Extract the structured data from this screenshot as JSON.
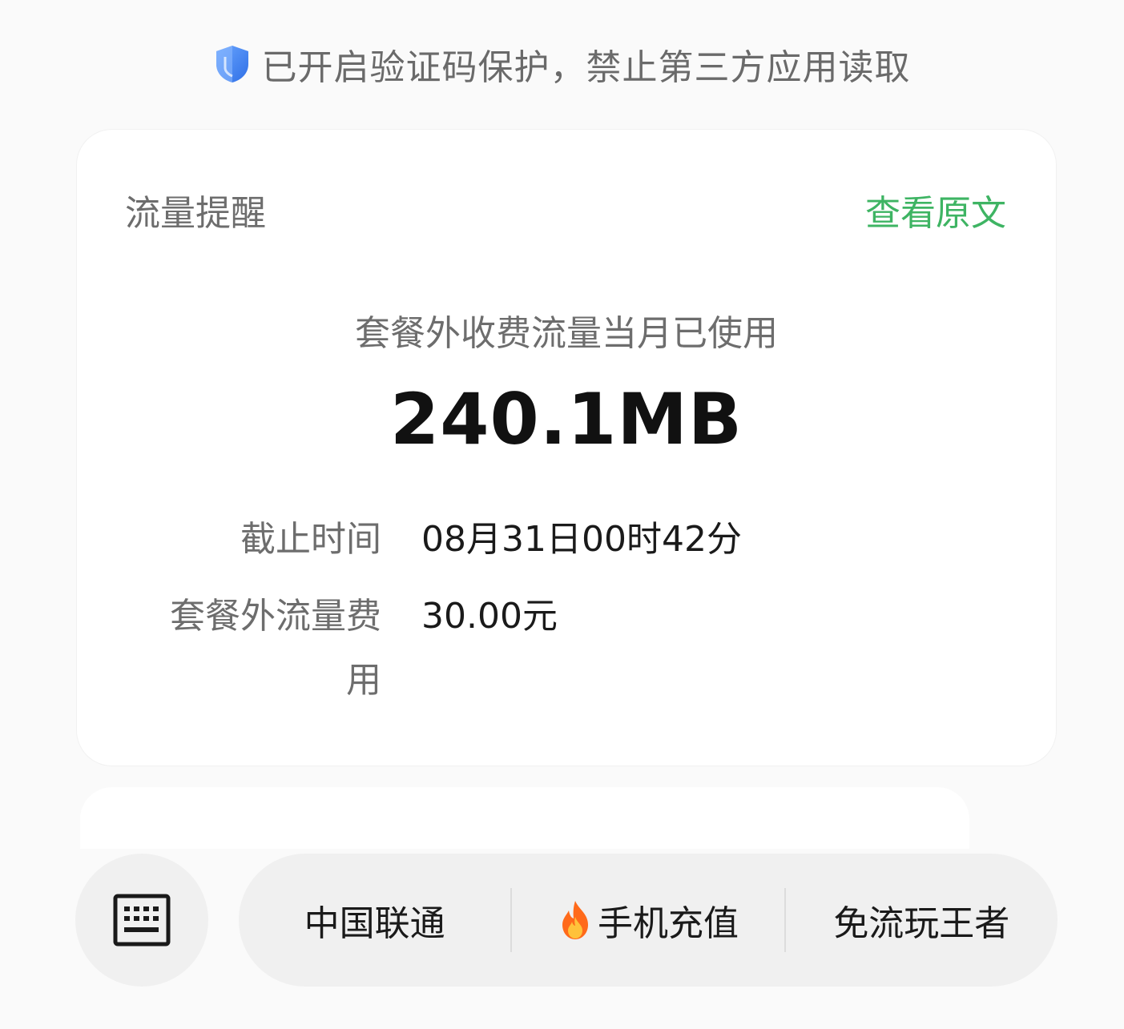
{
  "banner": {
    "text": "已开启验证码保护，禁止第三方应用读取",
    "icon": "shield-icon",
    "icon_color": "#4d8ff5"
  },
  "card": {
    "title": "流量提醒",
    "view_original": "查看原文",
    "link_color": "#3eb463",
    "usage_label": "套餐外收费流量当月已使用",
    "usage_value": "240.1MB",
    "details": [
      {
        "key": "截止时间",
        "value": "08月31日00时42分"
      },
      {
        "key": "套餐外流量费用",
        "value": "30.00元"
      }
    ]
  },
  "bottom_bar": {
    "keyboard_icon": "keyboard-icon",
    "menu": [
      {
        "label": "中国联通"
      },
      {
        "label": "手机充值",
        "icon": "fire-icon"
      },
      {
        "label": "免流玩王者"
      }
    ]
  }
}
